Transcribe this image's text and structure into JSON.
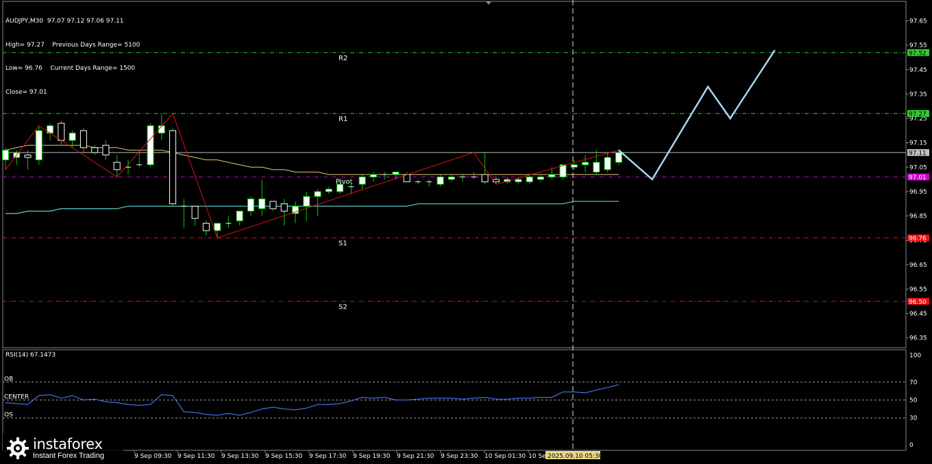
{
  "header": {
    "symbol_line": "AUDJPY,M30  97.07 97.12 97.06 97.11",
    "high_line": "High= 97.27    Previous Days Range= 5100",
    "low_line": "Low= 96.76    Current Days Range= 1500",
    "close_line": "Close= 97.01"
  },
  "rsi": {
    "title": "RSI(14) 67.1473"
  },
  "brand": {
    "name": "instaforex",
    "tagline": "Instant Forex Trading"
  },
  "colors": {
    "background": "#000000",
    "grid": "#444444",
    "bull_candle": "#ffffff",
    "bear_candle": "#000000",
    "wick": "#00cc00",
    "ma_fast": "#e8c878",
    "ma_slow": "#5fd3d3",
    "zigzag": "#dd1111",
    "forecast": "#a8d8f0",
    "rsi_line": "#4a6fe8",
    "resistance": "#33cc33",
    "pivot": "#d000d0",
    "support": "#ee1111"
  },
  "chart_data": [
    {
      "type": "candlestick",
      "symbol": "AUDJPY",
      "timeframe": "M30",
      "ylim": [
        96.31,
        97.73
      ],
      "y_ticks": [
        "97.65",
        "97.55",
        "97.45",
        "97.35",
        "97.25",
        "97.15",
        "97.05",
        "96.95",
        "96.85",
        "96.75",
        "96.65",
        "96.55",
        "96.45",
        "96.35"
      ],
      "x_labels": [
        "9 Sep 09:30",
        "9 Sep 11:30",
        "9 Sep 13:30",
        "9 Sep 15:30",
        "9 Sep 17:30",
        "9 Sep 19:30",
        "9 Sep 21:30",
        "9 Sep 23:30",
        "10 Sep 01:30",
        "10 Sep 03:30",
        "2025.09.10 05:30"
      ],
      "current_time_label": "2025.09.10 05:30",
      "current_price": "97.11",
      "levels": [
        {
          "name": "R2",
          "value": 97.52,
          "label": "97.52",
          "kind": "resistance"
        },
        {
          "name": "R1",
          "value": 97.27,
          "label": "97.27",
          "kind": "resistance"
        },
        {
          "name": "Pivot",
          "value": 97.01,
          "label": "97.01",
          "kind": "pivot"
        },
        {
          "name": "S1",
          "value": 96.76,
          "label": "96.76",
          "kind": "support"
        },
        {
          "name": "S2",
          "value": 96.5,
          "label": "96.50",
          "kind": "support"
        }
      ],
      "candles": [
        {
          "o": 97.08,
          "h": 97.13,
          "l": 97.04,
          "c": 97.12
        },
        {
          "o": 97.09,
          "h": 97.12,
          "l": 97.06,
          "c": 97.11
        },
        {
          "o": 97.1,
          "h": 97.12,
          "l": 97.04,
          "c": 97.09
        },
        {
          "o": 97.08,
          "h": 97.22,
          "l": 97.06,
          "c": 97.2
        },
        {
          "o": 97.19,
          "h": 97.23,
          "l": 97.16,
          "c": 97.22
        },
        {
          "o": 97.23,
          "h": 97.24,
          "l": 97.14,
          "c": 97.16
        },
        {
          "o": 97.16,
          "h": 97.2,
          "l": 97.13,
          "c": 97.19
        },
        {
          "o": 97.2,
          "h": 97.21,
          "l": 97.11,
          "c": 97.13
        },
        {
          "o": 97.13,
          "h": 97.14,
          "l": 97.1,
          "c": 97.11
        },
        {
          "o": 97.14,
          "h": 97.16,
          "l": 97.08,
          "c": 97.1
        },
        {
          "o": 97.07,
          "h": 97.1,
          "l": 97.01,
          "c": 97.04
        },
        {
          "o": 97.05,
          "h": 97.08,
          "l": 97.02,
          "c": 97.05
        },
        {
          "o": 97.06,
          "h": 97.12,
          "l": 97.05,
          "c": 97.06
        },
        {
          "o": 97.06,
          "h": 97.23,
          "l": 97.05,
          "c": 97.22
        },
        {
          "o": 97.19,
          "h": 97.27,
          "l": 97.16,
          "c": 97.22
        },
        {
          "o": 97.2,
          "h": 97.21,
          "l": 96.89,
          "c": 96.9
        },
        {
          "o": 96.89,
          "h": 96.92,
          "l": 96.8,
          "c": 96.89
        },
        {
          "o": 96.89,
          "h": 96.89,
          "l": 96.81,
          "c": 96.84
        },
        {
          "o": 96.82,
          "h": 96.83,
          "l": 96.77,
          "c": 96.79
        },
        {
          "o": 96.79,
          "h": 96.82,
          "l": 96.76,
          "c": 96.82
        },
        {
          "o": 96.82,
          "h": 96.85,
          "l": 96.8,
          "c": 96.82
        },
        {
          "o": 96.83,
          "h": 96.87,
          "l": 96.81,
          "c": 96.87
        },
        {
          "o": 96.87,
          "h": 96.93,
          "l": 96.85,
          "c": 96.92
        },
        {
          "o": 96.88,
          "h": 97.0,
          "l": 96.85,
          "c": 96.92
        },
        {
          "o": 96.91,
          "h": 96.91,
          "l": 96.87,
          "c": 96.88
        },
        {
          "o": 96.9,
          "h": 96.92,
          "l": 96.81,
          "c": 96.87
        },
        {
          "o": 96.86,
          "h": 96.91,
          "l": 96.82,
          "c": 96.89
        },
        {
          "o": 96.89,
          "h": 96.95,
          "l": 96.83,
          "c": 96.93
        },
        {
          "o": 96.93,
          "h": 96.96,
          "l": 96.85,
          "c": 96.95
        },
        {
          "o": 96.95,
          "h": 96.97,
          "l": 96.94,
          "c": 96.96
        },
        {
          "o": 96.95,
          "h": 96.99,
          "l": 96.94,
          "c": 96.98
        },
        {
          "o": 96.97,
          "h": 97.0,
          "l": 96.94,
          "c": 96.97
        },
        {
          "o": 96.98,
          "h": 97.02,
          "l": 96.96,
          "c": 97.01
        },
        {
          "o": 97.01,
          "h": 97.03,
          "l": 96.99,
          "c": 97.02
        },
        {
          "o": 97.02,
          "h": 97.03,
          "l": 97.0,
          "c": 97.02
        },
        {
          "o": 97.02,
          "h": 97.03,
          "l": 97.0,
          "c": 97.03
        },
        {
          "o": 97.02,
          "h": 97.03,
          "l": 96.99,
          "c": 96.99
        },
        {
          "o": 96.99,
          "h": 97.0,
          "l": 96.98,
          "c": 96.99
        },
        {
          "o": 96.99,
          "h": 97.0,
          "l": 96.97,
          "c": 96.99
        },
        {
          "o": 96.98,
          "h": 97.02,
          "l": 96.97,
          "c": 97.01
        },
        {
          "o": 97.0,
          "h": 97.02,
          "l": 96.99,
          "c": 97.01
        },
        {
          "o": 97.01,
          "h": 97.02,
          "l": 96.99,
          "c": 97.01
        },
        {
          "o": 97.01,
          "h": 97.03,
          "l": 97.0,
          "c": 97.01
        },
        {
          "o": 97.02,
          "h": 97.11,
          "l": 96.98,
          "c": 96.99
        },
        {
          "o": 97.0,
          "h": 97.01,
          "l": 96.98,
          "c": 96.99
        },
        {
          "o": 96.99,
          "h": 97.01,
          "l": 96.98,
          "c": 97.0
        },
        {
          "o": 96.99,
          "h": 97.01,
          "l": 96.98,
          "c": 97.0
        },
        {
          "o": 96.99,
          "h": 97.02,
          "l": 96.98,
          "c": 97.01
        },
        {
          "o": 97.0,
          "h": 97.02,
          "l": 96.99,
          "c": 97.01
        },
        {
          "o": 97.01,
          "h": 97.05,
          "l": 97.0,
          "c": 97.02
        },
        {
          "o": 97.01,
          "h": 97.06,
          "l": 97.0,
          "c": 97.06
        },
        {
          "o": 97.05,
          "h": 97.08,
          "l": 97.04,
          "c": 97.06
        },
        {
          "o": 97.06,
          "h": 97.1,
          "l": 97.03,
          "c": 97.07
        },
        {
          "o": 97.03,
          "h": 97.12,
          "l": 97.02,
          "c": 97.07
        },
        {
          "o": 97.04,
          "h": 97.11,
          "l": 97.03,
          "c": 97.09
        },
        {
          "o": 97.07,
          "h": 97.12,
          "l": 97.06,
          "c": 97.11
        }
      ],
      "ma_fast": [
        97.12,
        97.13,
        97.14,
        97.14,
        97.14,
        97.14,
        97.14,
        97.14,
        97.13,
        97.13,
        97.13,
        97.12,
        97.12,
        97.12,
        97.12,
        97.11,
        97.1,
        97.09,
        97.08,
        97.08,
        97.07,
        97.06,
        97.05,
        97.05,
        97.04,
        97.04,
        97.03,
        97.03,
        97.03,
        97.02,
        97.02,
        97.02,
        97.02,
        97.02,
        97.02,
        97.02,
        97.02,
        97.02,
        97.02,
        97.02,
        97.02,
        97.02,
        97.02,
        97.02,
        97.02,
        97.02,
        97.02,
        97.02,
        97.02,
        97.02,
        97.02,
        97.02,
        97.02,
        97.02,
        97.02,
        97.02
      ],
      "ma_slow": [
        96.86,
        96.86,
        96.87,
        96.87,
        96.87,
        96.88,
        96.88,
        96.88,
        96.88,
        96.88,
        96.88,
        96.89,
        96.89,
        96.89,
        96.89,
        96.89,
        96.89,
        96.89,
        96.89,
        96.89,
        96.89,
        96.89,
        96.89,
        96.89,
        96.89,
        96.89,
        96.89,
        96.89,
        96.89,
        96.89,
        96.89,
        96.89,
        96.89,
        96.89,
        96.89,
        96.89,
        96.89,
        96.9,
        96.9,
        96.9,
        96.9,
        96.9,
        96.9,
        96.9,
        96.9,
        96.9,
        96.9,
        96.9,
        96.9,
        96.9,
        96.9,
        96.91,
        96.91,
        96.91,
        96.91,
        96.91
      ],
      "zigzag": [
        [
          0,
          97.04
        ],
        [
          3,
          97.22
        ],
        [
          10,
          97.01
        ],
        [
          15,
          97.27
        ],
        [
          19,
          96.76
        ],
        [
          42,
          97.11
        ],
        [
          44,
          96.98
        ],
        [
          55,
          97.12
        ]
      ],
      "forecast": [
        [
          55,
          97.12
        ],
        [
          58,
          97.0
        ],
        [
          63,
          97.38
        ],
        [
          65,
          97.25
        ],
        [
          69,
          97.53
        ]
      ]
    },
    {
      "type": "line",
      "title": "RSI(14) 67.1473",
      "ylim": [
        0,
        100
      ],
      "y_ticks": [
        "100",
        "70",
        "50",
        "30",
        "0"
      ],
      "levels": [
        {
          "label": "OB",
          "value": 70
        },
        {
          "label": "CENTER",
          "value": 50
        },
        {
          "label": "OS",
          "value": 30
        }
      ],
      "values": [
        47,
        46,
        45,
        55,
        56,
        52,
        55,
        50,
        51,
        48,
        47,
        45,
        44,
        45,
        56,
        55,
        37,
        36,
        34,
        33,
        35,
        33,
        36,
        40,
        42,
        40,
        39,
        41,
        45,
        45,
        46,
        49,
        53,
        52,
        53,
        50,
        50,
        51,
        52,
        52,
        52,
        51,
        52,
        53,
        51,
        51,
        52,
        52,
        53,
        53,
        59,
        59,
        58,
        61,
        64,
        67
      ]
    }
  ]
}
